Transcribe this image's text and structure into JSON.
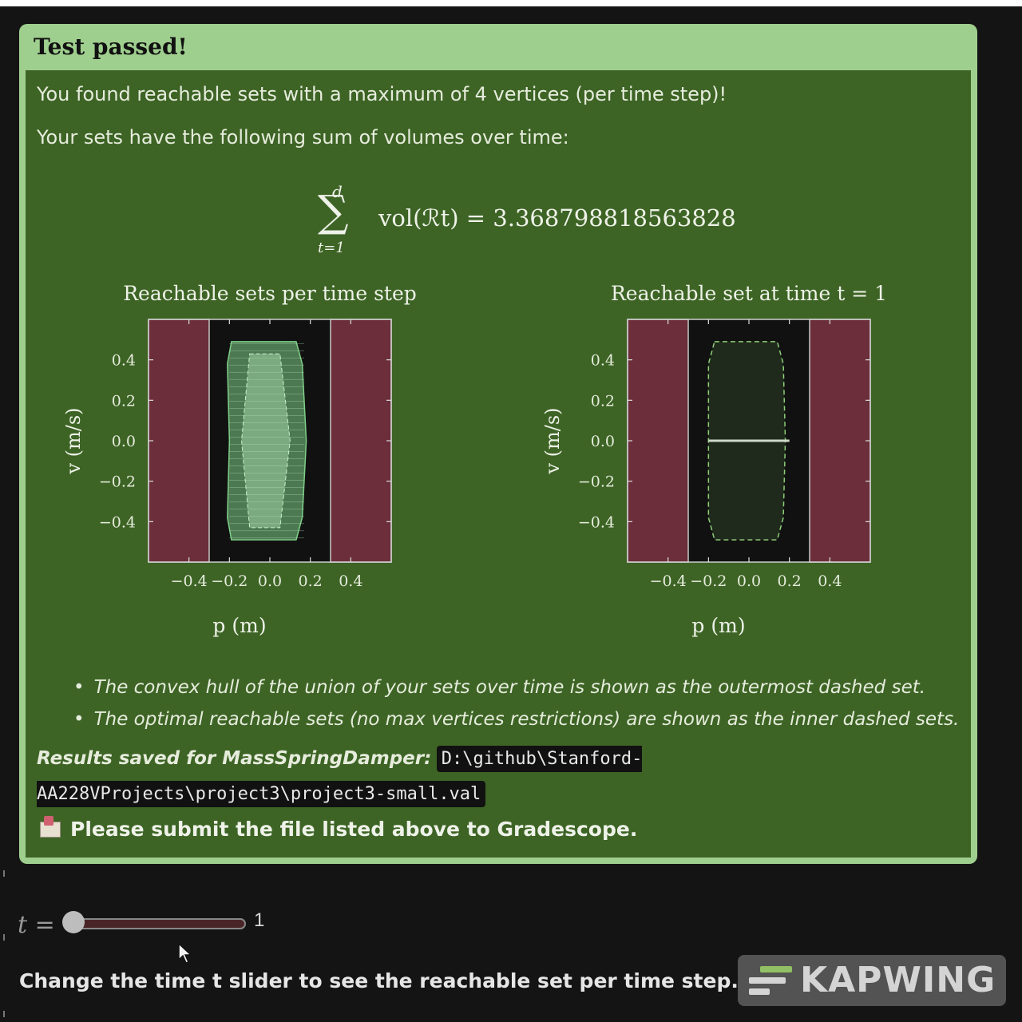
{
  "admonition": {
    "title": "Test passed!",
    "line1": "You found reachable sets with a maximum of 4 vertices (per time step)!",
    "line2": "Your sets have the following sum of volumes over time:",
    "formula": {
      "upper": "d",
      "lower": "t=1",
      "expression": "vol(ℛt) = 3.368798818563828"
    },
    "bullets": [
      "The convex hull of the union of your sets over time is shown as the outermost dashed set.",
      "The optimal reachable sets (no max vertices restrictions) are shown as the inner dashed sets."
    ],
    "results_label": "Results saved for MassSpringDamper:",
    "results_path": "D:\\github\\Stanford-AA228VProjects\\project3\\project3-small.val",
    "submit_text": "Please submit the file listed above to Gradescope."
  },
  "chart_data": [
    {
      "type": "area",
      "title": "Reachable sets per time step",
      "xlabel": "p (m)",
      "ylabel": "v (m/s)",
      "xlim": [
        -0.6,
        0.6
      ],
      "ylim": [
        -0.6,
        0.6
      ],
      "xticks": [
        "−0.4",
        "−0.2",
        "0.0",
        "0.2",
        "0.4"
      ],
      "yticks": [
        "0.4",
        "0.2",
        "0.0",
        "−0.2",
        "−0.4"
      ],
      "unsafe_regions": [
        {
          "p": [
            -0.6,
            -0.3
          ]
        },
        {
          "p": [
            0.3,
            0.6
          ]
        }
      ],
      "outer_set": [
        [
          -0.19,
          0.49
        ],
        [
          0.13,
          0.49
        ],
        [
          0.16,
          0.38
        ],
        [
          0.18,
          0.0
        ],
        [
          0.16,
          -0.38
        ],
        [
          0.13,
          -0.49
        ],
        [
          -0.19,
          -0.49
        ],
        [
          -0.21,
          -0.38
        ],
        [
          -0.2,
          0.0
        ],
        [
          -0.21,
          0.38
        ]
      ],
      "inner_set": [
        [
          -0.1,
          0.43
        ],
        [
          0.05,
          0.43
        ],
        [
          0.1,
          0.0
        ],
        [
          0.05,
          -0.43
        ],
        [
          -0.1,
          -0.43
        ],
        [
          -0.14,
          0.0
        ]
      ],
      "colors": {
        "plot_bg": "#111111",
        "unsafe": "#6b2e3a",
        "set": "#7fcf88"
      }
    },
    {
      "type": "area",
      "title": "Reachable set at time t = 1",
      "xlabel": "p (m)",
      "ylabel": "v (m/s)",
      "xlim": [
        -0.6,
        0.6
      ],
      "ylim": [
        -0.6,
        0.6
      ],
      "xticks": [
        "−0.4",
        "−0.2",
        "0.0",
        "0.2",
        "0.4"
      ],
      "yticks": [
        "0.4",
        "0.2",
        "0.0",
        "−0.2",
        "−0.4"
      ],
      "unsafe_regions": [
        {
          "p": [
            -0.6,
            -0.3
          ]
        },
        {
          "p": [
            0.3,
            0.6
          ]
        }
      ],
      "hull": [
        [
          -0.17,
          0.49
        ],
        [
          0.14,
          0.49
        ],
        [
          0.17,
          0.38
        ],
        [
          0.18,
          0.0
        ],
        [
          0.17,
          -0.38
        ],
        [
          0.14,
          -0.49
        ],
        [
          -0.17,
          -0.49
        ],
        [
          -0.2,
          -0.38
        ],
        [
          -0.2,
          0.0
        ],
        [
          -0.2,
          0.38
        ]
      ],
      "current_set": {
        "p": [
          -0.2,
          0.2
        ],
        "v": 0.0
      },
      "colors": {
        "plot_bg": "#111111",
        "unsafe": "#6b2e3a",
        "set": "#cfd8c8",
        "hull": "#8fcf7a"
      }
    }
  ],
  "slider": {
    "label": "t =",
    "value": "1",
    "fraction": 0.0
  },
  "instruction": "Change the time t slider to see the reachable set per time step.",
  "watermark": "KAPWING"
}
